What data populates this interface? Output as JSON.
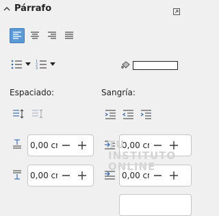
{
  "panel": {
    "title": "Párrafo"
  },
  "alignment": {
    "buttons": [
      {
        "name": "align-left-button",
        "icon": "align-left-icon",
        "active": true
      },
      {
        "name": "align-center-button",
        "icon": "align-center-icon",
        "active": false
      },
      {
        "name": "align-right-button",
        "icon": "align-right-icon",
        "active": false
      },
      {
        "name": "justify-button",
        "icon": "justify-icon",
        "active": false
      }
    ]
  },
  "lists": {
    "unordered_icon": "bullet-list-icon",
    "ordered_icon": "numbered-list-icon",
    "highlight_icon": "paragraph-background-icon"
  },
  "spacing": {
    "heading": "Espaciado:",
    "above_value": "0,00 cm",
    "below_value": "0,00 cm"
  },
  "indent": {
    "heading": "Sangría:",
    "before_value": "0,00 cm",
    "first_line_value": "0,00 cm"
  },
  "watermark": {
    "line1": "TU",
    "line2": "INSTITUTO",
    "line3": "ONLINE"
  },
  "colors": {
    "accent": "#5b9bd5",
    "panel_bg": "#f0f0f0",
    "icon_blue": "#3a6fb0"
  }
}
